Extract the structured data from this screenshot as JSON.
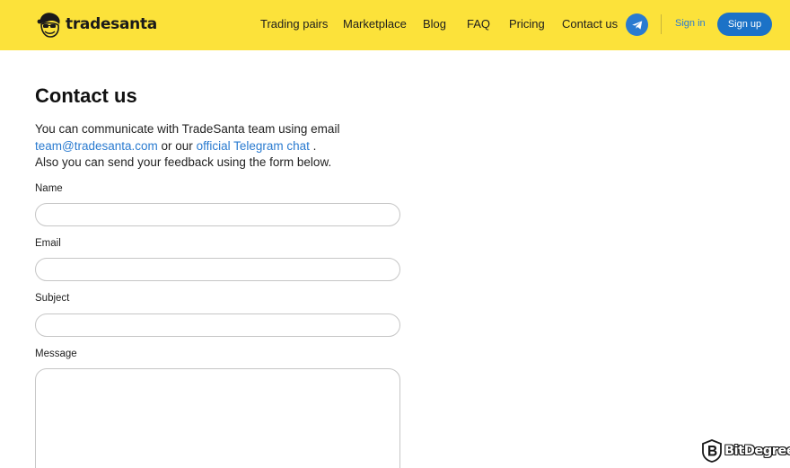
{
  "header": {
    "brand": "tradesanta",
    "logo_icon": "santa-sunglasses-icon",
    "nav": [
      {
        "label": "Trading pairs"
      },
      {
        "label": "Marketplace"
      },
      {
        "label": "Blog"
      },
      {
        "label": "FAQ"
      },
      {
        "label": "Pricing"
      },
      {
        "label": "Contact us"
      }
    ],
    "telegram_icon": "telegram-icon",
    "signin_label": "Sign in",
    "signup_label": "Sign up",
    "colors": {
      "bar": "#fce23a",
      "accent": "#2a7bd0",
      "button": "#1b72c7"
    }
  },
  "main": {
    "title": "Contact us",
    "intro": {
      "line1": "You can communicate with TradeSanta team using email",
      "email_link": "team@tradesanta.com",
      "middle": " or our ",
      "telegram_link": "official Telegram chat",
      "after": " .",
      "line3": "Also you can send your feedback using the form below."
    },
    "form": {
      "name_label": "Name",
      "email_label": "Email",
      "subject_label": "Subject",
      "message_label": "Message",
      "name_value": "",
      "email_value": "",
      "subject_value": ""
    }
  },
  "watermark": {
    "icon": "bitdegree-shield-icon",
    "text": "BitDegree"
  }
}
